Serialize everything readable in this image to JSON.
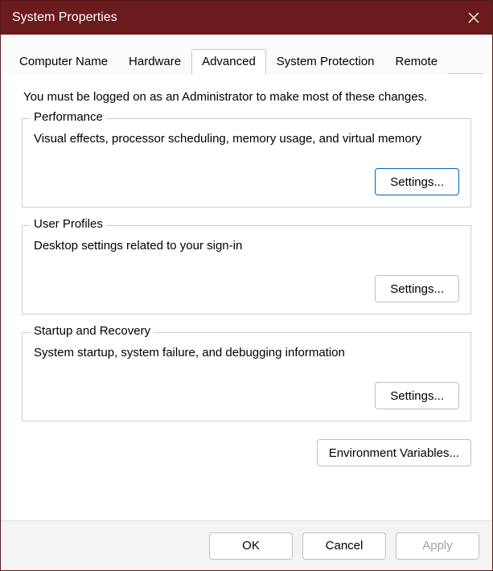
{
  "titlebar": {
    "title": "System Properties"
  },
  "tabs": [
    {
      "label": "Computer Name",
      "active": false
    },
    {
      "label": "Hardware",
      "active": false
    },
    {
      "label": "Advanced",
      "active": true
    },
    {
      "label": "System Protection",
      "active": false
    },
    {
      "label": "Remote",
      "active": false
    }
  ],
  "intro": "You must be logged on as an Administrator to make most of these changes.",
  "groups": {
    "performance": {
      "legend": "Performance",
      "desc": "Visual effects, processor scheduling, memory usage, and virtual memory",
      "button": "Settings..."
    },
    "userprofiles": {
      "legend": "User Profiles",
      "desc": "Desktop settings related to your sign-in",
      "button": "Settings..."
    },
    "startup": {
      "legend": "Startup and Recovery",
      "desc": "System startup, system failure, and debugging information",
      "button": "Settings..."
    }
  },
  "env_button": "Environment Variables...",
  "footer": {
    "ok": "OK",
    "cancel": "Cancel",
    "apply": "Apply"
  }
}
